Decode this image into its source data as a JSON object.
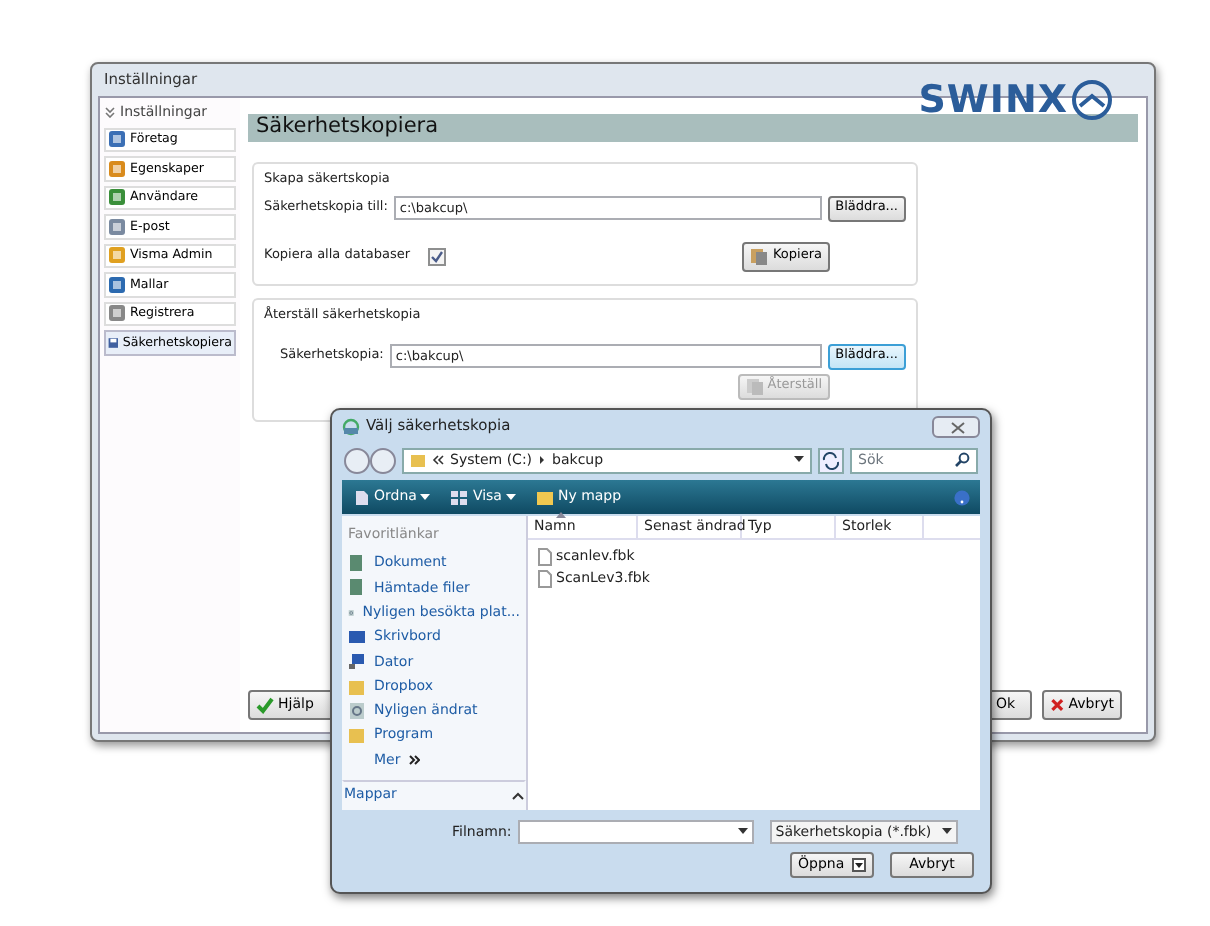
{
  "window": {
    "title": "Inställningar"
  },
  "sidebar": {
    "header": "Inställningar",
    "expanded": true,
    "items": [
      {
        "label": "Företag",
        "selected": false
      },
      {
        "label": "Egenskaper",
        "selected": false
      },
      {
        "label": "Användare",
        "selected": false
      },
      {
        "label": "E-post",
        "selected": false
      },
      {
        "label": "Visma Admin",
        "selected": false
      },
      {
        "label": "Mallar",
        "selected": false
      },
      {
        "label": "Registrera",
        "selected": false
      },
      {
        "label": "Säkerhetskopiera",
        "selected": true
      }
    ]
  },
  "header": {
    "title": "Säkerhetskopiera",
    "logo": "SWINX"
  },
  "backup": {
    "legend": "Skapa säkertskopia",
    "path_label": "Säkerhetskopia till:",
    "path": "c:\\bakcup\\",
    "browse": "Bläddra...",
    "copy_all_label": "Kopiera alla databaser",
    "copy_all_checked": true,
    "copy_button": "Kopiera"
  },
  "restore": {
    "legend": "Återställ säkerhetskopia",
    "path_label": "Säkerhetskopia:",
    "path": "c:\\bakcup\\",
    "browse": "Bläddra...",
    "browse_focused": true,
    "restore_button": "Återställ",
    "restore_disabled": true
  },
  "footer": {
    "buttons": [
      {
        "label": "Hjälp",
        "kind": "help"
      },
      {
        "label": "Ok",
        "kind": "ok"
      },
      {
        "label": "Avbryt",
        "kind": "cancel"
      }
    ]
  },
  "dialog": {
    "title": "Välj säkerhetskopia",
    "path": [
      "System (C:)",
      "bakcup"
    ],
    "search_placeholder": "Sök",
    "toolbar": [
      {
        "label": "Ordna",
        "kind": "organize"
      },
      {
        "label": "Visa",
        "kind": "view"
      },
      {
        "label": "Ny mapp",
        "kind": "folder"
      }
    ],
    "favorites_header": "Favoritlänkar",
    "favorites": [
      {
        "label": "Dokument",
        "kind": "doc"
      },
      {
        "label": "Hämtade filer",
        "kind": "doc"
      },
      {
        "label": "Nyligen besökta plat...",
        "kind": "recent"
      },
      {
        "label": "Skrivbord",
        "kind": "desktop"
      },
      {
        "label": "Dator",
        "kind": "computer"
      },
      {
        "label": "Dropbox",
        "kind": "folder"
      },
      {
        "label": "Nyligen ändrat",
        "kind": "recent"
      },
      {
        "label": "Program",
        "kind": "folder"
      },
      {
        "label": "Mer",
        "kind": "more"
      }
    ],
    "folders_label": "Mappar",
    "columns": [
      {
        "label": "Namn",
        "sorted": true
      },
      {
        "label": "Senast ändrad",
        "sorted": false
      },
      {
        "label": "Typ",
        "sorted": false
      },
      {
        "label": "Storlek",
        "sorted": false
      }
    ],
    "files": [
      "scanlev.fbk",
      "ScanLev3.fbk"
    ],
    "filename_label": "Filnamn:",
    "filter": "Säkerhetskopia (*.fbk)",
    "open_button": "Öppna",
    "cancel_button": "Avbryt"
  }
}
